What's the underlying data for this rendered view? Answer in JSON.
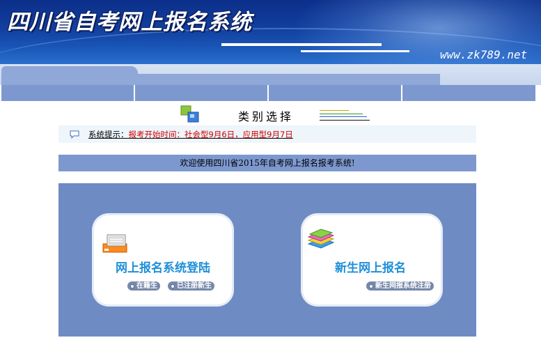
{
  "banner": {
    "title": "四川省自考网上报名系统",
    "url": "www.zk789.net"
  },
  "category": {
    "title": "类别选择"
  },
  "notice": {
    "prefix": "系统提示：",
    "message": "报考开始时间：社会型9月6日，应用型9月7日"
  },
  "welcome": {
    "text": "欢迎使用四川省2015年自考网上报名报考系统!"
  },
  "cards": [
    {
      "title": "网上报名系统登陆",
      "icon": "computer-icon",
      "links": [
        "在籍生",
        "已注册新生"
      ]
    },
    {
      "title": "新生网上报名",
      "icon": "books-icon",
      "links": [
        "新生网报系统注册"
      ]
    }
  ],
  "colors": {
    "banner": "#123f9f",
    "nav": "#7d98cf",
    "panel": "#6e8bc4",
    "card_title": "#1f8fd8",
    "notice_red": "#cc0000"
  }
}
